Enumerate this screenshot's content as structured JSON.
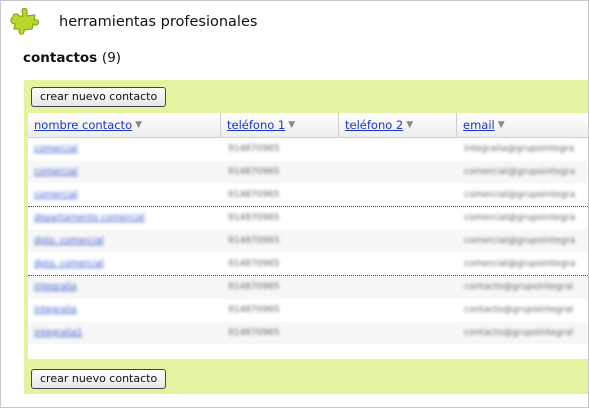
{
  "app": {
    "title": "herramientas profesionales"
  },
  "page": {
    "title": "contactos",
    "count": "(9)"
  },
  "buttons": {
    "new_contact": "crear nuevo contacto"
  },
  "table": {
    "columns": [
      "nombre contacto",
      "teléfono 1",
      "teléfono 2",
      "email"
    ],
    "rows": [
      {
        "name": "comercial",
        "tel1": "914870965",
        "tel2": "",
        "email": "integralia@grupointegra"
      },
      {
        "name": "comercial",
        "tel1": "914870965",
        "tel2": "",
        "email": "comercial@grupointegra"
      },
      {
        "name": "comercial",
        "tel1": "914870965",
        "tel2": "",
        "email": "comercial@grupointegra"
      },
      {
        "name": "departamento comercial",
        "tel1": "914870965",
        "tel2": "",
        "email": "comercial@grupointegra"
      },
      {
        "name": "dpto. comercial",
        "tel1": "914870965",
        "tel2": "",
        "email": "comercial@grupointegra"
      },
      {
        "name": "dpto. comercial",
        "tel1": "914870965",
        "tel2": "",
        "email": "comercial@grupointegra"
      },
      {
        "name": "integralia",
        "tel1": "914870965",
        "tel2": "",
        "email": "contacto@grupointegral"
      },
      {
        "name": "integralia",
        "tel1": "914870965",
        "tel2": "",
        "email": "contacto@grupointegral"
      },
      {
        "name": "integralia1",
        "tel1": "914870965",
        "tel2": "",
        "email": "contacto@grupointegral"
      }
    ]
  },
  "colors": {
    "panel": "#e3f4a1",
    "link": "#1a36c8",
    "logo": "#b6d82a"
  },
  "icons": {
    "logo": "puzzle-logo-icon",
    "sort": "sort-arrow-icon"
  }
}
